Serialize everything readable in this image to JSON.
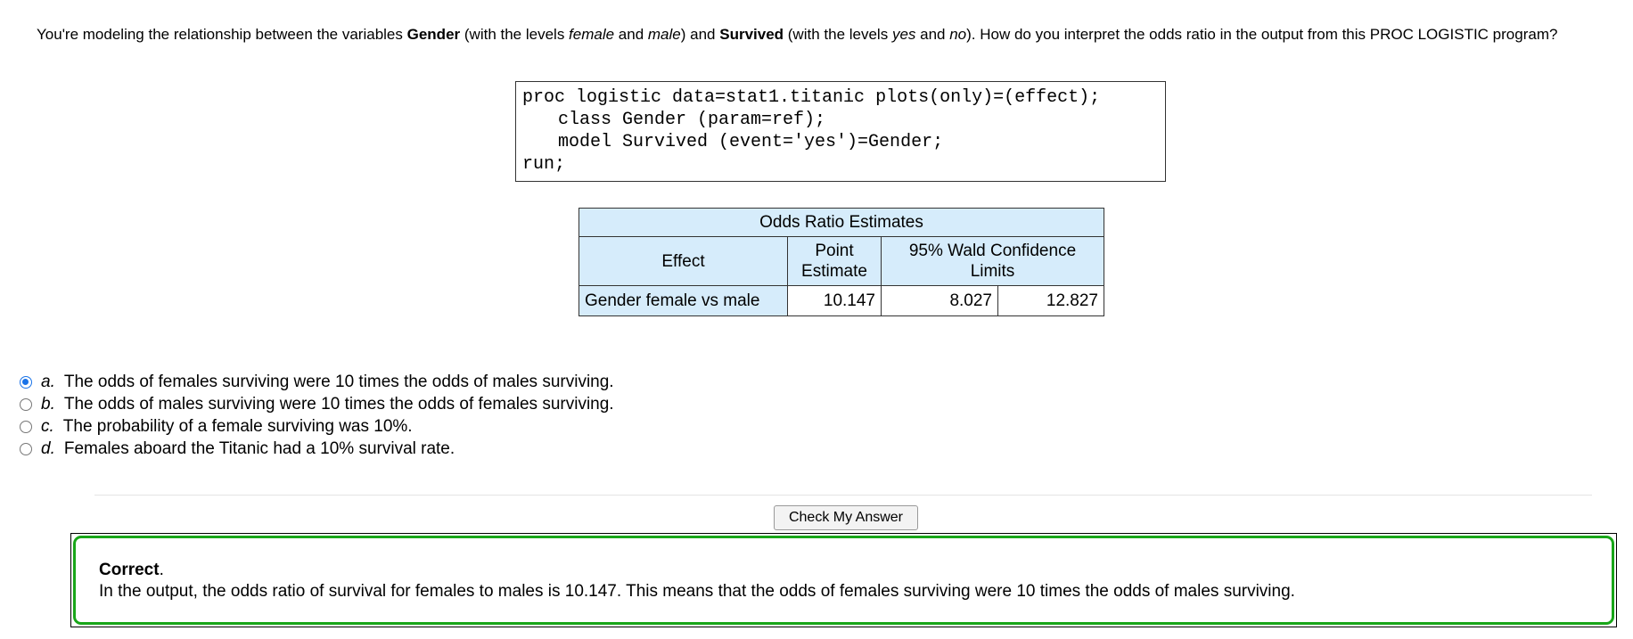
{
  "question": {
    "p1": "You're modeling the relationship between the variables ",
    "var1": "Gender",
    "p2": " (with the levels ",
    "lvl1": "female",
    "p3": " and ",
    "lvl2": "male",
    "p4": ") and ",
    "var2": "Survived",
    "p5": " (with the levels ",
    "lvl3": "yes",
    "p6": " and ",
    "lvl4": "no",
    "p7": "). How do you interpret the odds ratio in the output from this PROC LOGISTIC program?"
  },
  "code": [
    "proc logistic data=stat1.titanic plots(only)=(effect);",
    "class Gender (param=ref);",
    "model Survived (event='yes')=Gender;",
    "run;"
  ],
  "table": {
    "title": "Odds Ratio Estimates",
    "col_effect": "Effect",
    "col_point": "Point Estimate",
    "col_ci": "95% Wald Confidence Limits",
    "row": {
      "effect": "Gender female vs male",
      "point": "10.147",
      "lower": "8.027",
      "upper": "12.827"
    }
  },
  "options": [
    {
      "letter": "a.",
      "text": "The odds of females surviving were 10 times the odds of males surviving.",
      "selected": true
    },
    {
      "letter": "b.",
      "text": "The odds of males surviving were 10 times the odds of females surviving.",
      "selected": false
    },
    {
      "letter": "c.",
      "text": "The probability of a female surviving was 10%.",
      "selected": false
    },
    {
      "letter": "d.",
      "text": "Females aboard the Titanic had a 10% survival rate.",
      "selected": false
    }
  ],
  "check_button": "Check My Answer",
  "feedback": {
    "title": "Correct",
    "title_suffix": ".",
    "text": "In the output, the odds ratio of survival for females to males is 10.147. This means that the odds of females surviving were 10 times the odds of males surviving."
  },
  "colors": {
    "table_header_bg": "#d6ecfb",
    "radio_selected": "#1a73e8",
    "feedback_border": "#19a619"
  }
}
